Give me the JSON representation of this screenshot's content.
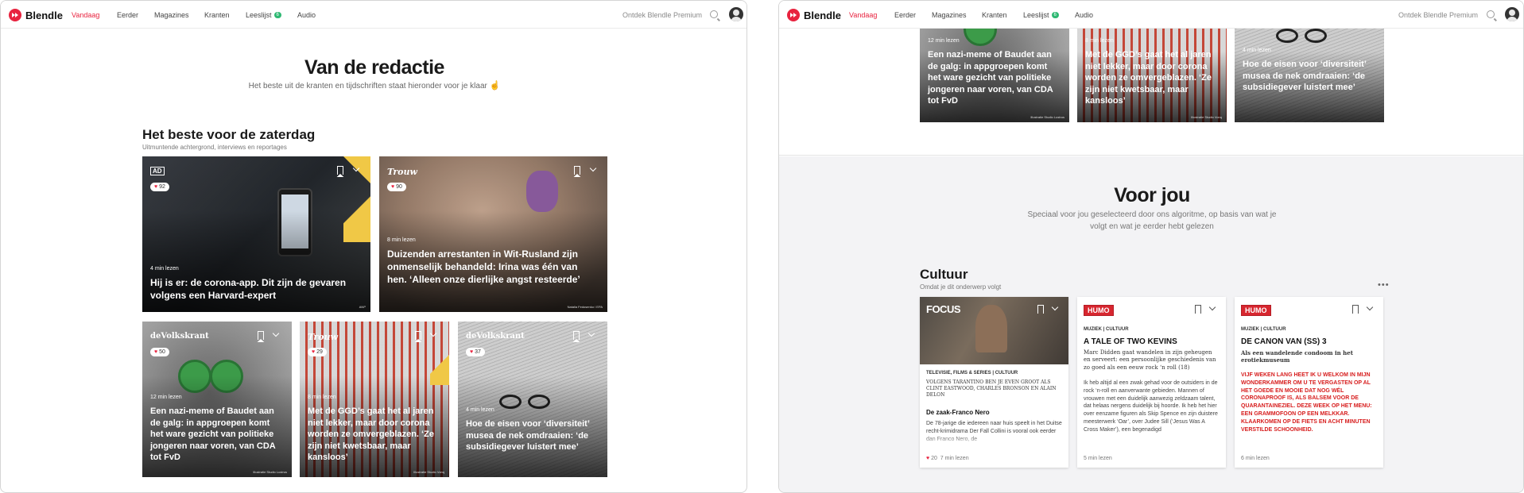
{
  "header": {
    "logo": "Blendle",
    "nav": [
      "Vandaag",
      "Eerder",
      "Magazines",
      "Kranten",
      "Leeslijst",
      "Audio"
    ],
    "leeslijst_badge": "6",
    "premium": "Ontdek Blendle Premium"
  },
  "left": {
    "title": "Van de redactie",
    "subtitle": "Het beste uit de kranten en tijdschriften staat hieronder voor je klaar",
    "section_title": "Het beste voor de zaterdag",
    "section_sub": "Uitmuntende achtergrond, interviews en reportages",
    "cards": [
      {
        "brand": "AD",
        "likes": "92",
        "read": "4 min lezen",
        "title": "Hij is er: de corona-app. Dit zijn de gevaren volgens een Harvard-expert",
        "credit": "ANP"
      },
      {
        "brand": "Trouw",
        "likes": "90",
        "read": "8 min lezen",
        "title": "Duizenden arrestanten in Wit-Rusland zijn onmenselijk behandeld: Irina was één van hen. ‘Alleen onze dierlijke angst resteerde’",
        "credit": "Natalia Fedosenko / EPA"
      },
      {
        "brand": "deVolkskrant",
        "likes": "50",
        "read": "12 min lezen",
        "title": "Een nazi-meme of Baudet aan de galg: in appgroepen komt het ware gezicht van politieke jongeren naar voren, van CDA tot FvD",
        "credit": "Illustratie Studio Lustrus"
      },
      {
        "brand": "Trouw",
        "likes": "29",
        "read": "8 min lezen",
        "title": "Met de GGD’s gaat het al jaren niet lekker, maar door corona worden ze omvergeblazen. ‘Ze zijn niet kwetsbaar, maar kansloos’",
        "credit": "Illustratie Studio Vonq"
      },
      {
        "brand": "deVolkskrant",
        "likes": "37",
        "read": "4 min lezen",
        "title": "Hoe de eisen voor ‘diversiteit’ musea de nek omdraaien: ‘de subsidiegever luistert mee’",
        "credit": ""
      }
    ]
  },
  "right": {
    "top_cards": [
      {
        "read": "12 min lezen",
        "title": "Een nazi-meme of Baudet aan de galg: in appgroepen komt het ware gezicht van politieke jongeren naar voren, van CDA tot FvD",
        "credit": "Illustratie Studio Lustrus"
      },
      {
        "read": "8 min lezen",
        "title": "Met de GGD’s gaat het al jaren niet lekker, maar door corona worden ze omvergeblazen. ‘Ze zijn niet kwetsbaar, maar kansloos’",
        "credit": "Illustratie Studio Vonq"
      },
      {
        "read": "4 min lezen",
        "title": "Hoe de eisen voor ‘diversiteit’ musea de nek omdraaien: ‘de subsidiegever luistert mee’",
        "credit": ""
      }
    ],
    "title": "Voor jou",
    "subtitle_1": "Speciaal voor jou geselecteerd door ons algoritme, op basis van wat je",
    "subtitle_2": "volgt en wat je eerder hebt gelezen",
    "section_title": "Cultuur",
    "section_sub": "Omdat je dit onderwerp volgt",
    "more": "•••",
    "articles": [
      {
        "brand": "FOCUS",
        "category": "Televisie, films & series | Cultuur",
        "kicker": "VOLGENS TARANTINO BEN JE EVEN GROOT ALS CLINT EASTWOOD, CHARLES BRONSON EN ALAIN DELON",
        "title": "De zaak-Franco Nero",
        "body": "De 78-jarige die iedereen naar huis speelt in het Duitse recht-krimidrama Der Fall Collini is vooral ook eerder dan Franco Nero, de",
        "likes": "20",
        "read": "7 min lezen"
      },
      {
        "brand": "HUMO",
        "category": "Muziek | Cultuur",
        "title": "A TALE OF TWO KEVINS",
        "intro": "Marc Didden gaat wandelen in zijn geheugen en serveert: een persoonlijke geschiedenis van zo goed als een eeuw rock ‘n roll (18)",
        "body": "Ik heb altijd al een zwak gehad voor de outsiders in de rock ‘n-roll en aanverwante gebieden. Mannen of vrouwen met een duidelijk aanwezig zeldzaam talent, dat helaas nergens duidelijk bij hoorde. Ik heb het hier over eenzame figuren als Skip Spence en zijn duistere meesterwerk ‘Oar’, over Judee Sill (‘Jesus Was A Cross Maker’), een begenadigd",
        "read": "5 min lezen"
      },
      {
        "brand": "HUMO",
        "category": "Muziek | Cultuur",
        "title": "DE CANON VAN (SS) 3",
        "intro": "Als een wandelende condoom in het erotiekmuseum",
        "body": "Vijf weken lang heet ik u welkom in mijn wonderkammer om u te vergasten op al het goede en mooie dat nog wél coronaproof is, als balsem voor de quarantaineziel. Deze week op het menu: een grammofoon op een melkkar. Klaarkomen op de fiets en acht minuten verstilde schoonheid.",
        "read": "6 min lezen"
      }
    ]
  }
}
